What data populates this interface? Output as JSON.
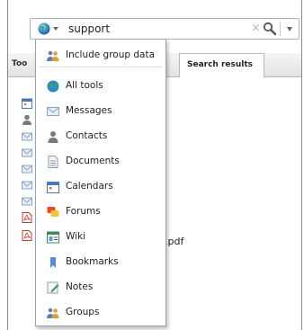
{
  "search": {
    "query": "support",
    "clear_glyph": "×",
    "scope_icon": "globe-icon",
    "search_icon": "magnifier-icon"
  },
  "tabs": {
    "tools_label_partial": "Too",
    "results_label": "Search results"
  },
  "background_list": {
    "visible_file_suffix": ".pdf"
  },
  "menu": {
    "include_group": {
      "label": "Include group data",
      "icon": "group-icon"
    },
    "items": [
      {
        "label": "All tools",
        "icon": "globe-icon"
      },
      {
        "label": "Messages",
        "icon": "envelope-icon"
      },
      {
        "label": "Contacts",
        "icon": "person-icon"
      },
      {
        "label": "Documents",
        "icon": "document-icon"
      },
      {
        "label": "Calendars",
        "icon": "calendar-icon"
      },
      {
        "label": "Forums",
        "icon": "forum-icon"
      },
      {
        "label": "Wiki",
        "icon": "wiki-icon"
      },
      {
        "label": "Bookmarks",
        "icon": "bookmark-icon"
      },
      {
        "label": "Notes",
        "icon": "note-icon"
      },
      {
        "label": "Groups",
        "icon": "groups-icon"
      }
    ]
  },
  "colors": {
    "accent_blue": "#3a7bd5",
    "border": "#9aa3ad"
  }
}
